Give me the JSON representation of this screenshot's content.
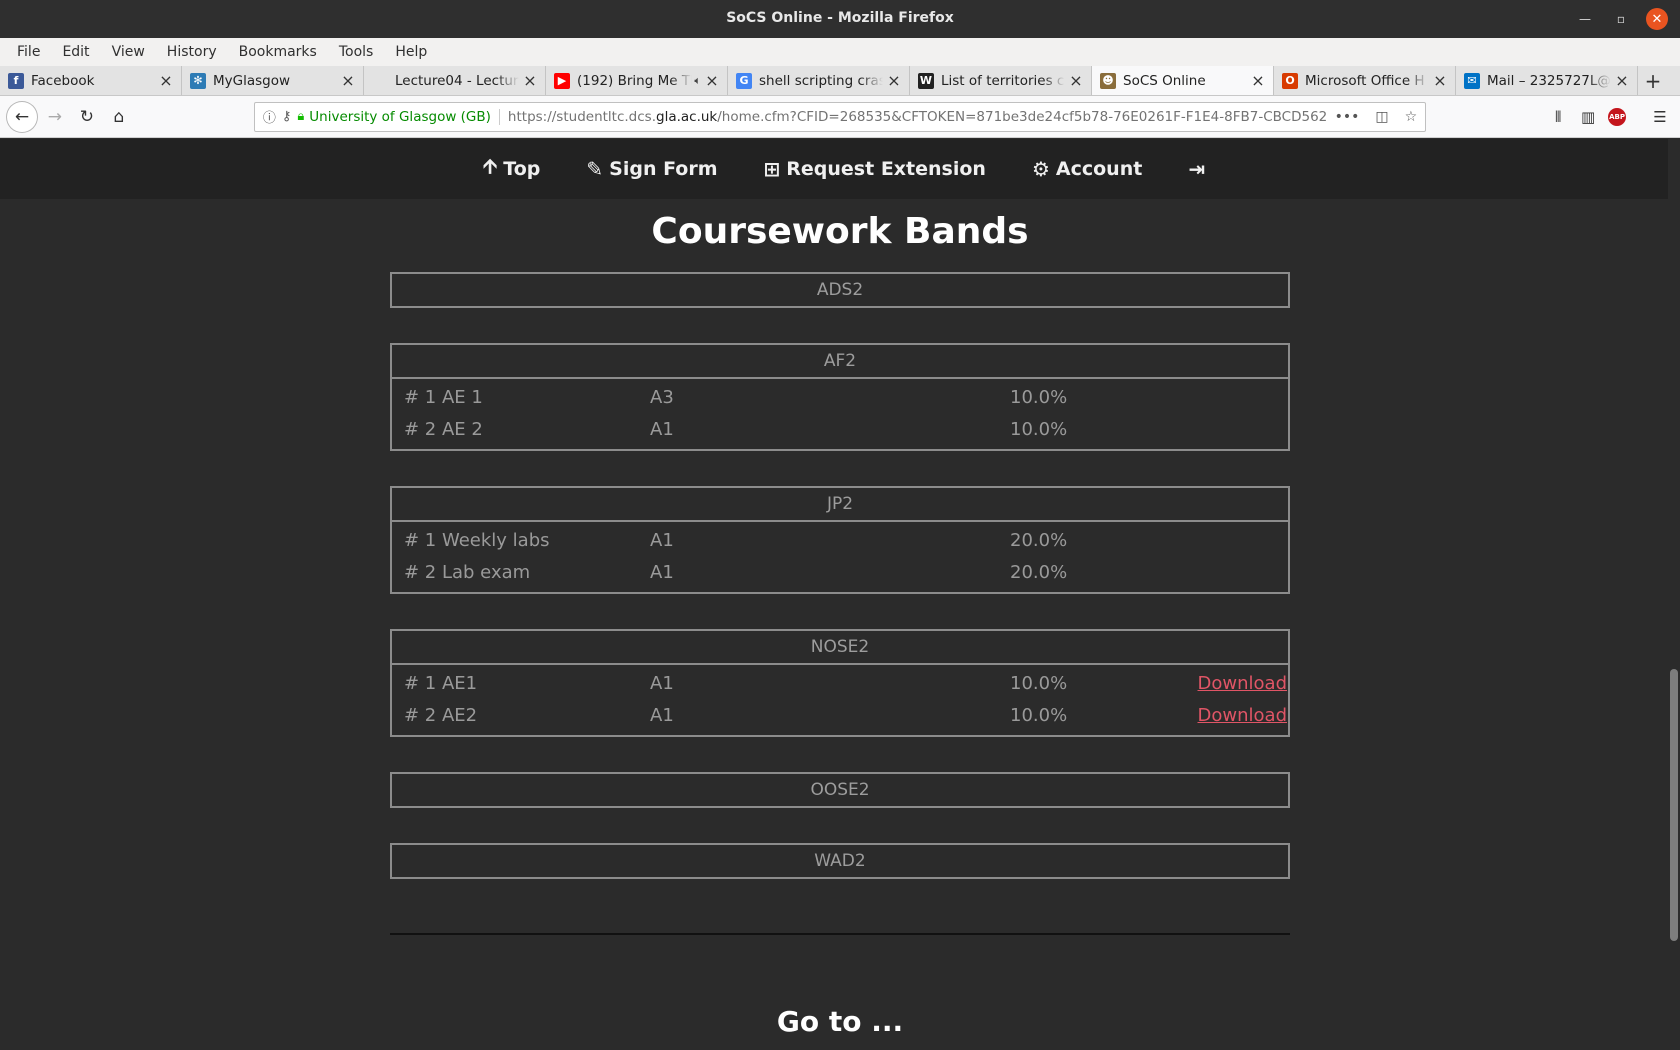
{
  "window": {
    "title": "SoCS Online - Mozilla Firefox"
  },
  "menubar": [
    "File",
    "Edit",
    "View",
    "History",
    "Bookmarks",
    "Tools",
    "Help"
  ],
  "tabs": [
    {
      "label": "Facebook",
      "icon": "f",
      "icon_color": "#3b5998"
    },
    {
      "label": "MyGlasgow",
      "icon": "✻",
      "icon_color": "#2d7bb5"
    },
    {
      "label": "Lecture04 - Lecture04",
      "icon": "",
      "icon_color": "#e3e3e3"
    },
    {
      "label": "(192) Bring Me Th",
      "icon": "▶",
      "icon_color": "#ff0000"
    },
    {
      "label": "shell scripting cras",
      "icon": "G",
      "icon_color": "#4285f4"
    },
    {
      "label": "List of territories c",
      "icon": "W",
      "icon_color": "#222222"
    },
    {
      "label": "SoCS Online",
      "icon": "☻",
      "icon_color": "#8a6d3b"
    },
    {
      "label": "Microsoft Office H",
      "icon": "O",
      "icon_color": "#d83b01"
    },
    {
      "label": "Mail – 2325727L@",
      "icon": "✉",
      "icon_color": "#0072c6"
    }
  ],
  "urlbar": {
    "org": "University of Glasgow (GB)",
    "url_prefix": "https://studentltc.dcs.",
    "url_domain": "gla.ac.uk",
    "url_rest": "/home.cfm?CFID=268535&CFTOKEN=871be3de24cf5b78-76E0261F-F1E4-8FB7-CBCD562"
  },
  "site_nav": {
    "top": "Top",
    "sign_form": "Sign Form",
    "request_extension": "Request Extension",
    "account": "Account"
  },
  "heading": "Coursework Bands",
  "bands": [
    {
      "course": "ADS2",
      "items": []
    },
    {
      "course": "AF2",
      "items": [
        {
          "id": "# 1 AE 1",
          "band": "A3",
          "weight": "10.0%",
          "action": ""
        },
        {
          "id": "# 2 AE 2",
          "band": "A1",
          "weight": "10.0%",
          "action": ""
        }
      ]
    },
    {
      "course": "JP2",
      "items": [
        {
          "id": "# 1 Weekly labs",
          "band": "A1",
          "weight": "20.0%",
          "action": ""
        },
        {
          "id": "# 2 Lab exam",
          "band": "A1",
          "weight": "20.0%",
          "action": ""
        }
      ]
    },
    {
      "course": "NOSE2",
      "items": [
        {
          "id": "# 1 AE1",
          "band": "A1",
          "weight": "10.0%",
          "action": "Download"
        },
        {
          "id": "# 2 AE2",
          "band": "A1",
          "weight": "10.0%",
          "action": "Download"
        }
      ]
    },
    {
      "course": "OOSE2",
      "items": []
    },
    {
      "course": "WAD2",
      "items": []
    }
  ],
  "goto": "Go to ..."
}
